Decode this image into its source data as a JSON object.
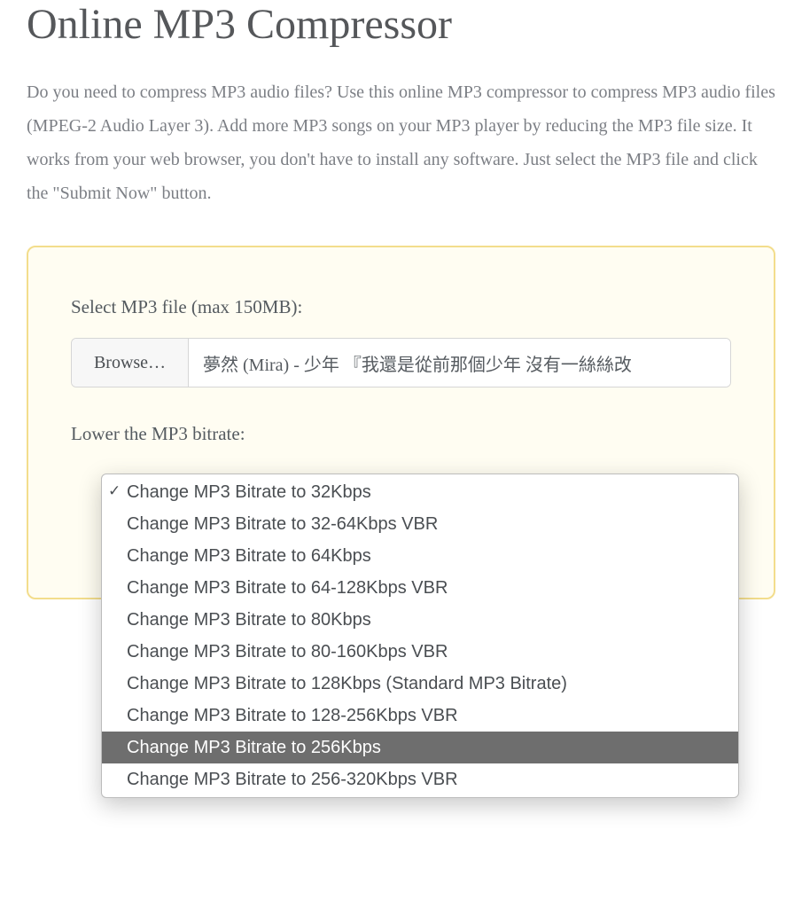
{
  "title": "Online MP3 Compressor",
  "intro": "Do you need to compress MP3 audio files? Use this online MP3 compressor to compress MP3 audio files (MPEG-2 Audio Layer 3). Add more MP3 songs on your MP3 player by reducing the MP3 file size. It works from your web browser, you don't have to install any software. Just select the MP3 file and click the \"Submit Now\" button.",
  "form": {
    "file_label": "Select MP3 file (max 150MB):",
    "browse_label": "Browse…",
    "file_name": "夢然 (Mira) - 少年 『我還是從前那個少年 沒有一絲絲改",
    "bitrate_label": "Lower the MP3 bitrate:"
  },
  "dropdown": {
    "selected_index": 0,
    "hover_index": 8,
    "options": [
      "Change MP3 Bitrate to 32Kbps",
      "Change MP3 Bitrate to 32-64Kbps VBR",
      "Change MP3 Bitrate to 64Kbps",
      "Change MP3 Bitrate to 64-128Kbps VBR",
      "Change MP3 Bitrate to 80Kbps",
      "Change MP3 Bitrate to 80-160Kbps VBR",
      "Change MP3 Bitrate to 128Kbps (Standard MP3 Bitrate)",
      "Change MP3 Bitrate to 128-256Kbps VBR",
      "Change MP3 Bitrate to 256Kbps",
      "Change MP3 Bitrate to 256-320Kbps VBR"
    ]
  }
}
